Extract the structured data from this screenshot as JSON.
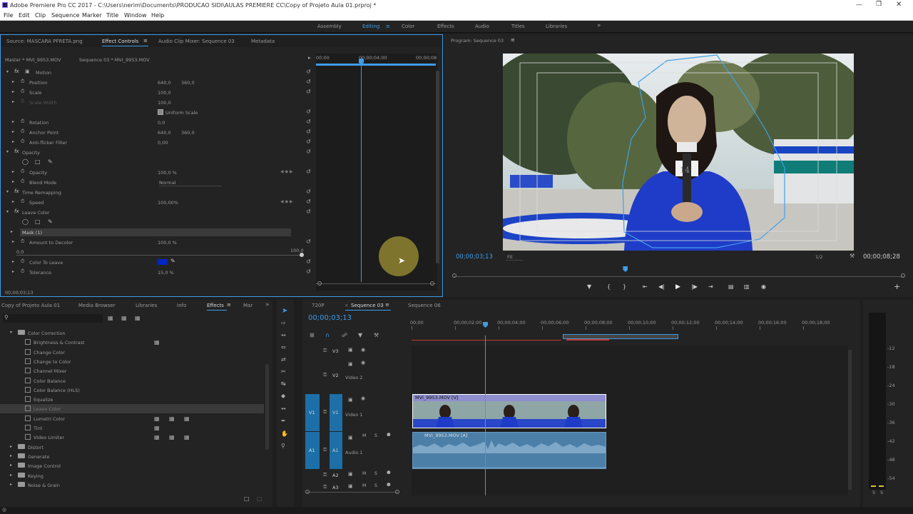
{
  "app": {
    "title": "Adobe Premiere Pro CC 2017 - C:\\Users\\nerim\\Documents\\PRODUCAO SIDI\\AULAS PREMIERE CC\\Copy of Projeto Aula 01.prproj *"
  },
  "menu": [
    "File",
    "Edit",
    "Clip",
    "Sequence",
    "Marker",
    "Title",
    "Window",
    "Help"
  ],
  "workspaces": [
    "Assembly",
    "Editing",
    "Color",
    "Effects",
    "Audio",
    "Titles",
    "Libraries"
  ],
  "active_workspace": "Editing",
  "source_panel": {
    "tabs": [
      "Source: MASCARA PFRETA.png",
      "Effect Controls",
      "Audio Clip Mixer: Sequence 03",
      "Metadata"
    ],
    "active_tab": "Effect Controls",
    "master_label": "Master * MVI_9953.MOV",
    "sequence_label": "Sequence 03 * MVI_9953.MOV",
    "ruler": [
      "00;00",
      "00;00;04;00",
      "00;00;08"
    ],
    "current_time": "00;00;03;13",
    "rows": [
      {
        "name": "Motion",
        "v1": "",
        "v2": "",
        "kind": "fx"
      },
      {
        "name": "Position",
        "v1": "640,0",
        "v2": "360,0",
        "kind": "prop"
      },
      {
        "name": "Scale",
        "v1": "100,0",
        "v2": "",
        "kind": "prop"
      },
      {
        "name": "Scale Width",
        "v1": "100,0",
        "v2": "",
        "kind": "dim"
      },
      {
        "name": "Uniform Scale",
        "v1": "",
        "v2": "",
        "kind": "check"
      },
      {
        "name": "Rotation",
        "v1": "0,0",
        "v2": "",
        "kind": "prop"
      },
      {
        "name": "Anchor Point",
        "v1": "640,0",
        "v2": "360,0",
        "kind": "prop"
      },
      {
        "name": "Anti-flicker Filter",
        "v1": "0,00",
        "v2": "",
        "kind": "prop"
      },
      {
        "name": "Opacity",
        "v1": "",
        "v2": "",
        "kind": "fx"
      },
      {
        "name": "",
        "v1": "",
        "v2": "",
        "kind": "mask-tools"
      },
      {
        "name": "Opacity",
        "v1": "100,0 %",
        "v2": "",
        "kind": "prop"
      },
      {
        "name": "Blend Mode",
        "v1": "Normal",
        "v2": "",
        "kind": "select"
      },
      {
        "name": "Time Remapping",
        "v1": "",
        "v2": "",
        "kind": "fx"
      },
      {
        "name": "Speed",
        "v1": "100,00%",
        "v2": "",
        "kind": "prop"
      },
      {
        "name": "Leave Color",
        "v1": "",
        "v2": "",
        "kind": "fx"
      },
      {
        "name": "",
        "v1": "",
        "v2": "",
        "kind": "mask-tools"
      },
      {
        "name": "Mask (1)",
        "v1": "",
        "v2": "",
        "kind": "mask"
      },
      {
        "name": "Amount to Decolor",
        "v1": "100,0 %",
        "v2": "",
        "kind": "prop"
      },
      {
        "name": "",
        "v1": "0,0",
        "v2": "100,0",
        "kind": "slider"
      },
      {
        "name": "Color To Leave",
        "v1": "",
        "v2": "",
        "kind": "color"
      },
      {
        "name": "Tolerance",
        "v1": "15,0 %",
        "v2": "",
        "kind": "prop"
      }
    ]
  },
  "program_monitor": {
    "tab": "Program: Sequence 03",
    "timecode": "00;00;03;13",
    "fit": "Fit",
    "resolution": "1/2",
    "duration": "00;00;08;28",
    "badge_text": "14",
    "playhead_fraction": 0.38
  },
  "project_panel": {
    "tabs": [
      "Copy of Projeto Aula 01",
      "Media Browser",
      "Libraries",
      "Info",
      "Effects",
      "Mar"
    ],
    "active_tab": "Effects",
    "search_placeholder": "",
    "tree": [
      {
        "label": "Color Correction",
        "level": 1,
        "folder": true,
        "open": true
      },
      {
        "label": "Brightness & Contrast",
        "level": 2,
        "badges": 1
      },
      {
        "label": "Change Color",
        "level": 2,
        "badges": 0
      },
      {
        "label": "Change to Color",
        "level": 2,
        "badges": 0
      },
      {
        "label": "Channel Mixer",
        "level": 2,
        "badges": 0
      },
      {
        "label": "Color Balance",
        "level": 2,
        "badges": 0
      },
      {
        "label": "Color Balance (HLS)",
        "level": 2,
        "badges": 0
      },
      {
        "label": "Equalize",
        "level": 2,
        "badges": 0
      },
      {
        "label": "Leave Color",
        "level": 2,
        "badges": 0,
        "selected": true
      },
      {
        "label": "Lumetri Color",
        "level": 2,
        "badges": 3
      },
      {
        "label": "Tint",
        "level": 2,
        "badges": 1
      },
      {
        "label": "Video Limiter",
        "level": 2,
        "badges": 3
      },
      {
        "label": "Distort",
        "level": 1,
        "folder": true
      },
      {
        "label": "Generate",
        "level": 1,
        "folder": true
      },
      {
        "label": "Image Control",
        "level": 1,
        "folder": true
      },
      {
        "label": "Keying",
        "level": 1,
        "folder": true
      },
      {
        "label": "Noise & Grain",
        "level": 1,
        "folder": true
      }
    ]
  },
  "timeline": {
    "tabs": [
      "720P",
      "Sequence 03",
      "Sequence 06"
    ],
    "active_tab": "Sequence 03",
    "timecode": "00;00;03;13",
    "ruler": [
      "00;00",
      "00;00;02;00",
      "00;00;04;00",
      "00;00;06;00",
      "00;00;08;00",
      "00;00;10;00",
      "00;00;12;00",
      "00;00;14;00",
      "00;00;16;00",
      "00;00;18;00"
    ],
    "tracks": [
      {
        "id": "V3",
        "name": ""
      },
      {
        "id": "V2",
        "name": "Video 2"
      },
      {
        "id": "V1",
        "name": "Video 1",
        "src": "V1"
      },
      {
        "id": "A1",
        "name": "Audio 1",
        "src": "A1"
      },
      {
        "id": "A2",
        "name": ""
      },
      {
        "id": "A3",
        "name": ""
      }
    ],
    "video_clip": "MVI_9953.MOV [V]",
    "audio_clip": "MVI_9953.MOV [A]"
  },
  "audio_meter": {
    "labels": [
      "-12",
      "-18",
      "-24",
      "-30",
      "-36",
      "-42",
      "-48",
      "-54"
    ],
    "footer": [
      "S",
      "S"
    ]
  },
  "colors": {
    "accent": "#3e9ce8",
    "track_src": "#1d6fa8",
    "clip_video": "#8e8ed0",
    "clip_audio": "#4b7fa8",
    "leave_color": "#0026c8"
  }
}
